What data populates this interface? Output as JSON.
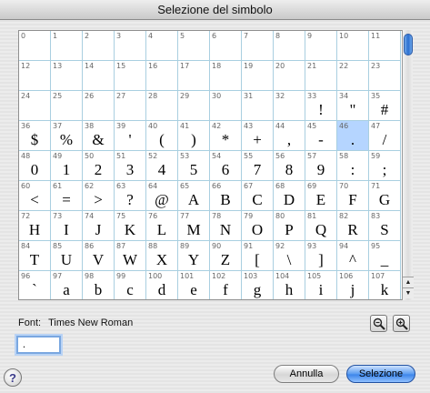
{
  "window": {
    "title": "Selezione del simbolo"
  },
  "symbols": [
    {
      "num": "0",
      "char": ""
    },
    {
      "num": "1",
      "char": ""
    },
    {
      "num": "2",
      "char": ""
    },
    {
      "num": "3",
      "char": ""
    },
    {
      "num": "4",
      "char": ""
    },
    {
      "num": "5",
      "char": ""
    },
    {
      "num": "6",
      "char": ""
    },
    {
      "num": "7",
      "char": ""
    },
    {
      "num": "8",
      "char": ""
    },
    {
      "num": "9",
      "char": ""
    },
    {
      "num": "10",
      "char": ""
    },
    {
      "num": "11",
      "char": ""
    },
    {
      "num": "12",
      "char": ""
    },
    {
      "num": "13",
      "char": ""
    },
    {
      "num": "14",
      "char": ""
    },
    {
      "num": "15",
      "char": ""
    },
    {
      "num": "16",
      "char": ""
    },
    {
      "num": "17",
      "char": ""
    },
    {
      "num": "18",
      "char": ""
    },
    {
      "num": "19",
      "char": ""
    },
    {
      "num": "20",
      "char": ""
    },
    {
      "num": "21",
      "char": ""
    },
    {
      "num": "22",
      "char": ""
    },
    {
      "num": "23",
      "char": ""
    },
    {
      "num": "24",
      "char": ""
    },
    {
      "num": "25",
      "char": ""
    },
    {
      "num": "26",
      "char": ""
    },
    {
      "num": "27",
      "char": ""
    },
    {
      "num": "28",
      "char": ""
    },
    {
      "num": "29",
      "char": ""
    },
    {
      "num": "30",
      "char": ""
    },
    {
      "num": "31",
      "char": ""
    },
    {
      "num": "32",
      "char": ""
    },
    {
      "num": "33",
      "char": "!"
    },
    {
      "num": "34",
      "char": "\""
    },
    {
      "num": "35",
      "char": "#"
    },
    {
      "num": "36",
      "char": "$"
    },
    {
      "num": "37",
      "char": "%"
    },
    {
      "num": "38",
      "char": "&"
    },
    {
      "num": "39",
      "char": "'"
    },
    {
      "num": "40",
      "char": "("
    },
    {
      "num": "41",
      "char": ")"
    },
    {
      "num": "42",
      "char": "*"
    },
    {
      "num": "43",
      "char": "+"
    },
    {
      "num": "44",
      "char": ","
    },
    {
      "num": "45",
      "char": "-"
    },
    {
      "num": "46",
      "char": "."
    },
    {
      "num": "47",
      "char": "/"
    },
    {
      "num": "48",
      "char": "0"
    },
    {
      "num": "49",
      "char": "1"
    },
    {
      "num": "50",
      "char": "2"
    },
    {
      "num": "51",
      "char": "3"
    },
    {
      "num": "52",
      "char": "4"
    },
    {
      "num": "53",
      "char": "5"
    },
    {
      "num": "54",
      "char": "6"
    },
    {
      "num": "55",
      "char": "7"
    },
    {
      "num": "56",
      "char": "8"
    },
    {
      "num": "57",
      "char": "9"
    },
    {
      "num": "58",
      "char": ":"
    },
    {
      "num": "59",
      "char": ";"
    },
    {
      "num": "60",
      "char": "<"
    },
    {
      "num": "61",
      "char": "="
    },
    {
      "num": "62",
      "char": ">"
    },
    {
      "num": "63",
      "char": "?"
    },
    {
      "num": "64",
      "char": "@"
    },
    {
      "num": "65",
      "char": "A"
    },
    {
      "num": "66",
      "char": "B"
    },
    {
      "num": "67",
      "char": "C"
    },
    {
      "num": "68",
      "char": "D"
    },
    {
      "num": "69",
      "char": "E"
    },
    {
      "num": "70",
      "char": "F"
    },
    {
      "num": "71",
      "char": "G"
    },
    {
      "num": "72",
      "char": "H"
    },
    {
      "num": "73",
      "char": "I"
    },
    {
      "num": "74",
      "char": "J"
    },
    {
      "num": "75",
      "char": "K"
    },
    {
      "num": "76",
      "char": "L"
    },
    {
      "num": "77",
      "char": "M"
    },
    {
      "num": "78",
      "char": "N"
    },
    {
      "num": "79",
      "char": "O"
    },
    {
      "num": "80",
      "char": "P"
    },
    {
      "num": "81",
      "char": "Q"
    },
    {
      "num": "82",
      "char": "R"
    },
    {
      "num": "83",
      "char": "S"
    },
    {
      "num": "84",
      "char": "T"
    },
    {
      "num": "85",
      "char": "U"
    },
    {
      "num": "86",
      "char": "V"
    },
    {
      "num": "87",
      "char": "W"
    },
    {
      "num": "88",
      "char": "X"
    },
    {
      "num": "89",
      "char": "Y"
    },
    {
      "num": "90",
      "char": "Z"
    },
    {
      "num": "91",
      "char": "["
    },
    {
      "num": "92",
      "char": "\\"
    },
    {
      "num": "93",
      "char": "]"
    },
    {
      "num": "94",
      "char": "^"
    },
    {
      "num": "95",
      "char": "_"
    },
    {
      "num": "96",
      "char": "`"
    },
    {
      "num": "97",
      "char": "a"
    },
    {
      "num": "98",
      "char": "b"
    },
    {
      "num": "99",
      "char": "c"
    },
    {
      "num": "100",
      "char": "d"
    },
    {
      "num": "101",
      "char": "e"
    },
    {
      "num": "102",
      "char": "f"
    },
    {
      "num": "103",
      "char": "g"
    },
    {
      "num": "104",
      "char": "h"
    },
    {
      "num": "105",
      "char": "i"
    },
    {
      "num": "106",
      "char": "j"
    },
    {
      "num": "107",
      "char": "k"
    }
  ],
  "selected_index": 46,
  "font": {
    "label": "Font:",
    "name": "Times New Roman"
  },
  "preview": {
    "value": "."
  },
  "buttons": {
    "cancel": "Annulla",
    "select": "Selezione",
    "help": "?"
  },
  "icons": {
    "zoom_out": "zoom-out-icon",
    "zoom_in": "zoom-in-icon",
    "scroll_up": "scroll-up-arrow-icon",
    "scroll_down": "scroll-down-arrow-icon"
  },
  "colors": {
    "selected_cell": "#b5d5ff",
    "grid_line": "#a9cfe0",
    "accent": "#3d86ea"
  }
}
